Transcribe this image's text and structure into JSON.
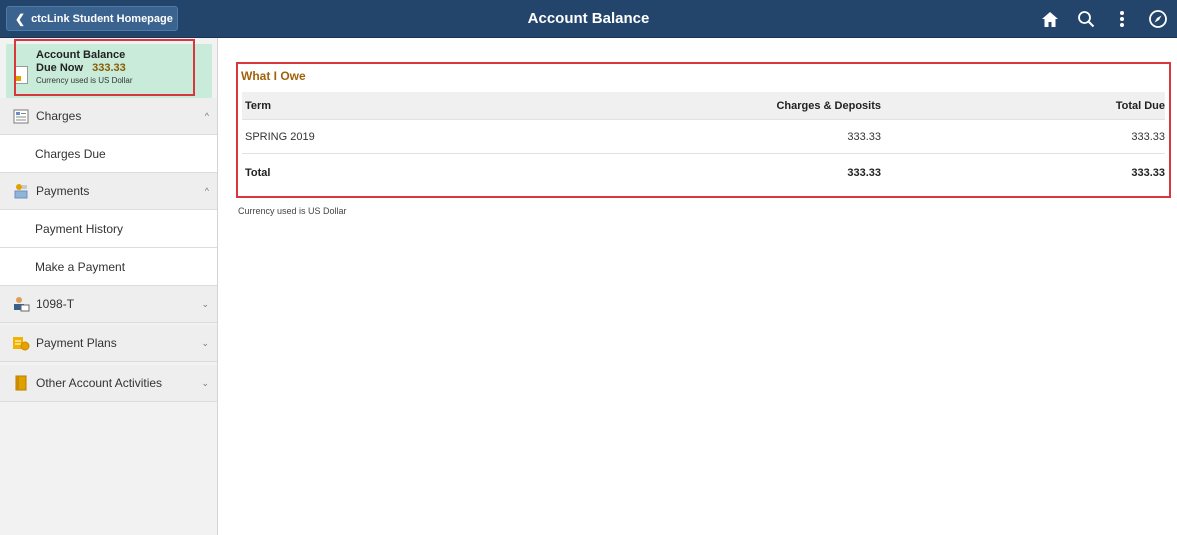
{
  "header": {
    "back_label": "ctcLink Student Homepage",
    "title": "Account Balance",
    "icons": [
      "home-icon",
      "search-icon",
      "more-vertical-icon",
      "compass-icon"
    ]
  },
  "sidebar": {
    "summary": {
      "title": "Account Balance",
      "due_label": "Due Now",
      "due_amount": "333.33",
      "currency_note": "Currency used is US Dollar"
    },
    "items": [
      {
        "label": "Charges",
        "type": "group",
        "icon": "charges-icon",
        "expanded": true
      },
      {
        "label": "Charges Due",
        "type": "sub"
      },
      {
        "label": "Payments",
        "type": "group",
        "icon": "payments-icon",
        "expanded": true
      },
      {
        "label": "Payment History",
        "type": "sub"
      },
      {
        "label": "Make a Payment",
        "type": "sub"
      },
      {
        "label": "1098-T",
        "type": "group",
        "icon": "tax-form-icon",
        "expanded": false
      },
      {
        "label": "Payment Plans",
        "type": "group",
        "icon": "payment-plans-icon",
        "expanded": false
      },
      {
        "label": "Other Account Activities",
        "type": "group",
        "icon": "other-activities-icon",
        "expanded": false
      }
    ]
  },
  "main": {
    "section_title": "What I Owe",
    "table": {
      "headers": [
        "Term",
        "Charges & Deposits",
        "Total Due"
      ],
      "rows": [
        {
          "term": "SPRING 2019",
          "charges": "333.33",
          "due": "333.33"
        }
      ],
      "total": {
        "label": "Total",
        "charges": "333.33",
        "due": "333.33"
      }
    },
    "currency_note": "Currency used is US Dollar"
  },
  "colors": {
    "header_bg": "#24456b",
    "accent_title": "#a0620a",
    "highlight_outline": "#d9363e",
    "summary_bg": "#c9ecda"
  }
}
